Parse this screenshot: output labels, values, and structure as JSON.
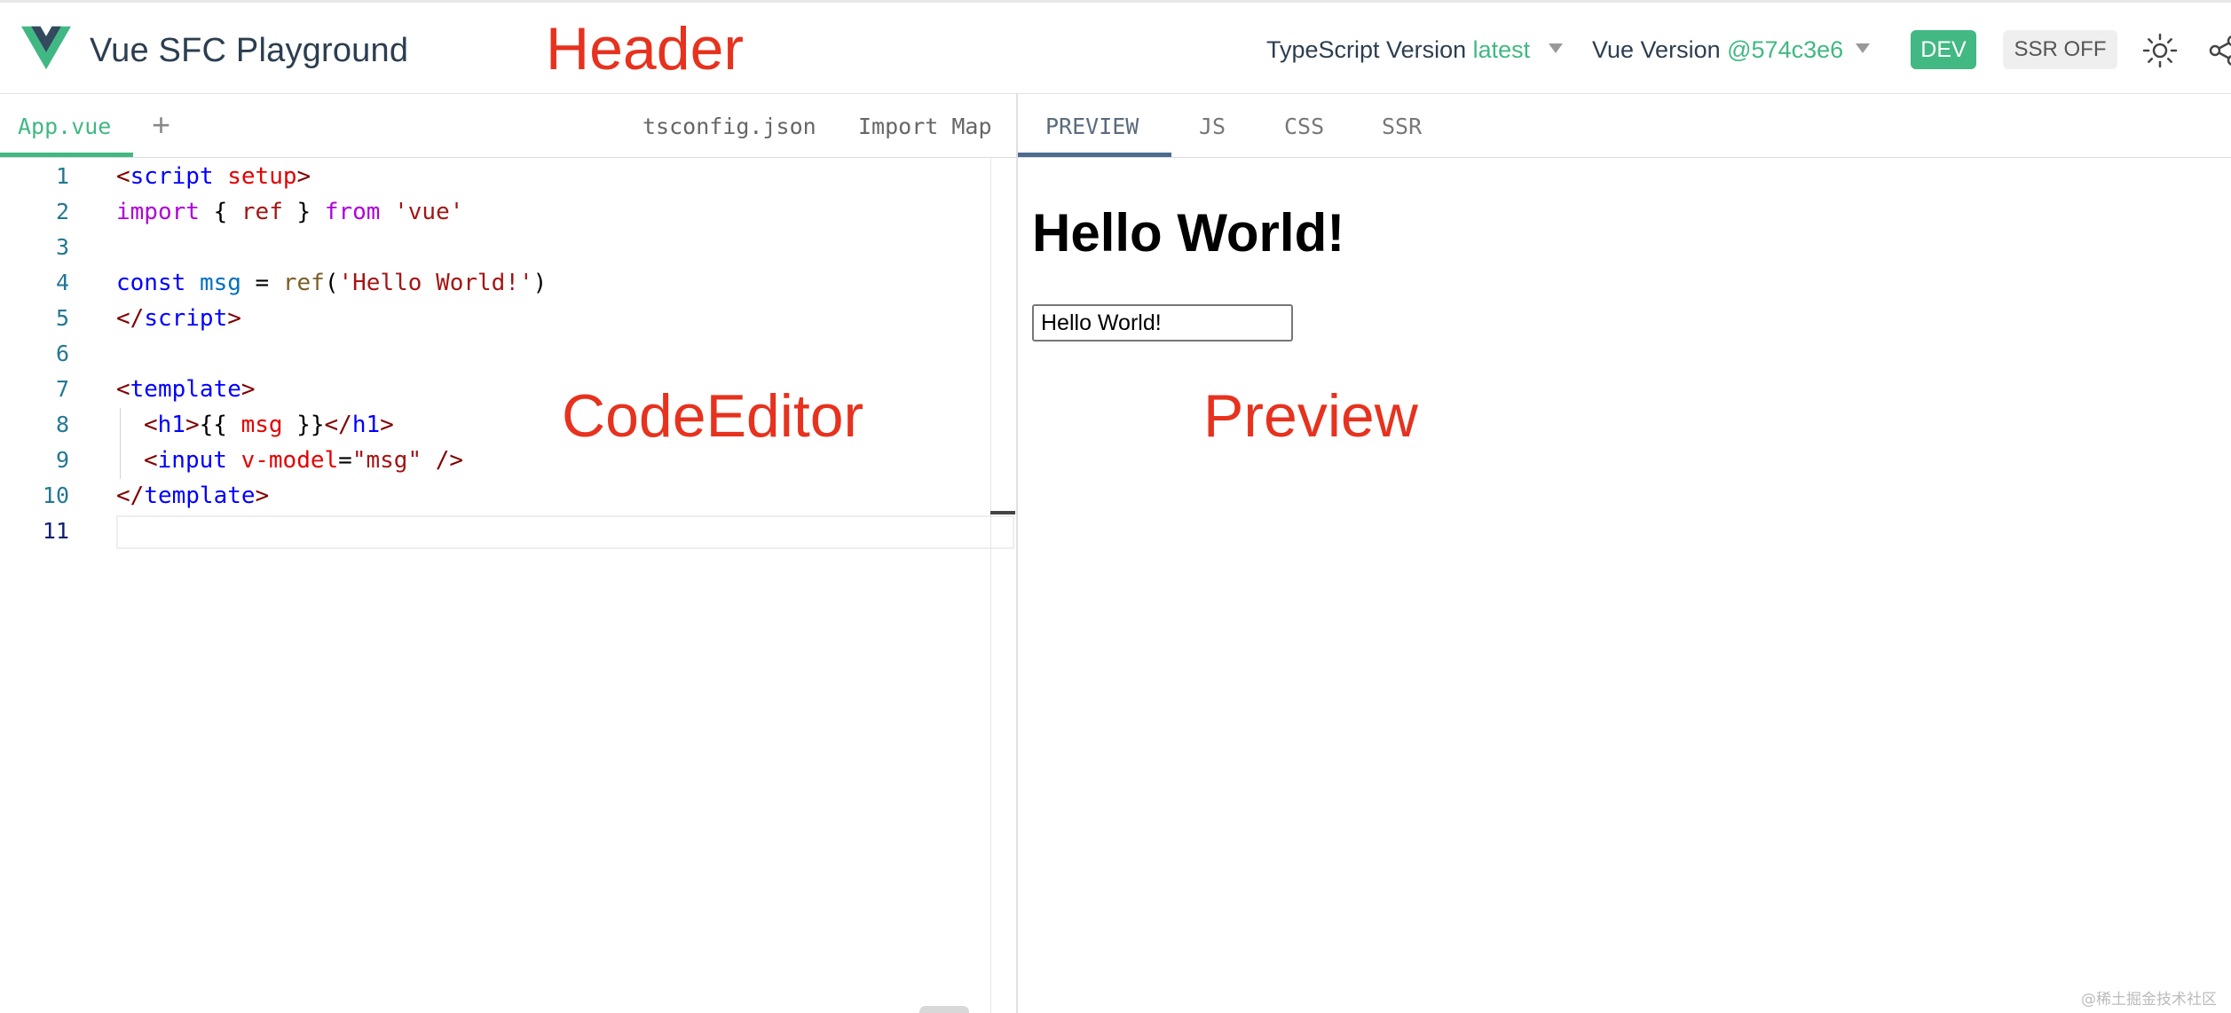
{
  "header": {
    "title": "Vue SFC Playground",
    "typescript_label": "TypeScript Version",
    "typescript_value": "latest",
    "vue_label": "Vue Version",
    "vue_value": "@574c3e6",
    "dev_label": "DEV",
    "ssr_label": "SSR OFF",
    "icons": [
      "vue-logo",
      "sun-icon",
      "share-icon"
    ]
  },
  "annotations": {
    "header": "Header",
    "editor": "CodeEditor",
    "preview": "Preview"
  },
  "file_tabs": {
    "active": "App.vue",
    "add": "+",
    "tsconfig": "tsconfig.json",
    "import_map": "Import Map"
  },
  "editor": {
    "line_numbers": [
      "1",
      "2",
      "3",
      "4",
      "5",
      "6",
      "7",
      "8",
      "9",
      "10",
      "11"
    ],
    "lines": {
      "l1": {
        "a": "<",
        "b": "script",
        "c": " ",
        "d": "setup",
        "e": ">"
      },
      "l2": {
        "a": "import",
        "b": " { ",
        "c": "ref",
        "d": " } ",
        "e": "from",
        "f": " ",
        "g": "'vue'"
      },
      "l4": {
        "a": "const",
        "b": " ",
        "c": "msg",
        "d": " = ",
        "e": "ref",
        "f": "(",
        "g": "'Hello World!'",
        "h": ")"
      },
      "l5": {
        "a": "</",
        "b": "script",
        "c": ">"
      },
      "l7": {
        "a": "<",
        "b": "template",
        "c": ">"
      },
      "l8": {
        "a": "<",
        "b": "h1",
        "c": ">",
        "d": "{{ ",
        "e": "msg",
        "f": " }}",
        "g": "</",
        "h": "h1",
        "i": ">"
      },
      "l9": {
        "a": "<",
        "b": "input",
        "c": " ",
        "d": "v-model",
        "e": "=",
        "f": "\"msg\"",
        "g": " />"
      },
      "l10": {
        "a": "</",
        "b": "template",
        "c": ">"
      }
    }
  },
  "output_tabs": {
    "preview": "PREVIEW",
    "js": "JS",
    "css": "CSS",
    "ssr": "SSR"
  },
  "preview": {
    "heading": "Hello World!",
    "input_value": "Hello World!"
  },
  "watermark": "@稀土掘金技术社区",
  "colors": {
    "vue_green": "#42b883",
    "vue_dark": "#35495e",
    "annotation_red": "#e6321e",
    "preview_tab_underline": "#4b6a8f"
  }
}
